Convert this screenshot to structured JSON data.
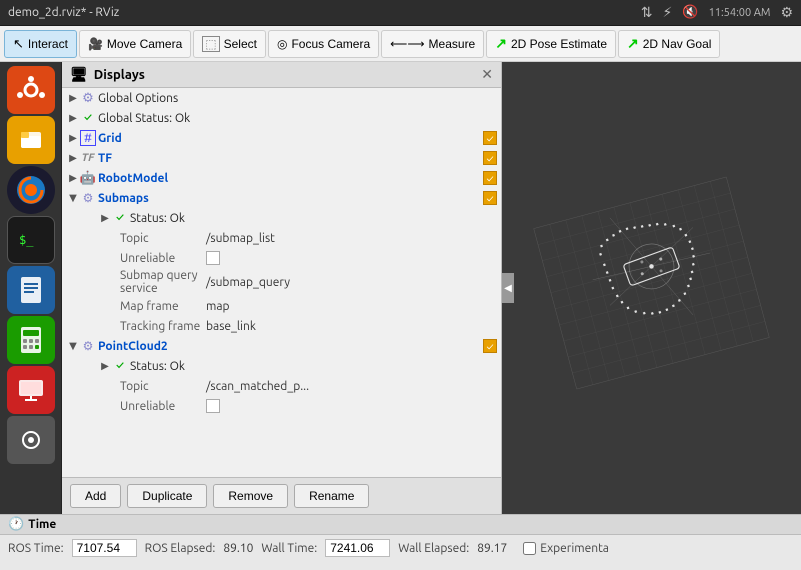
{
  "titlebar": {
    "title": "demo_2d.rviz* - RViz",
    "bluetooth_icon": "bluetooth",
    "sound_icon": "sound",
    "time": "11:54:00 AM",
    "settings_icon": "settings"
  },
  "toolbar": {
    "interact_label": "Interact",
    "move_camera_label": "Move Camera",
    "select_label": "Select",
    "focus_camera_label": "Focus Camera",
    "measure_label": "Measure",
    "pose_estimate_label": "2D Pose Estimate",
    "nav_goal_label": "2D Nav Goal"
  },
  "displays": {
    "title": "Displays",
    "items": [
      {
        "label": "Global Options",
        "indent": 1,
        "type": "options"
      },
      {
        "label": "Global Status: Ok",
        "indent": 1,
        "type": "status",
        "status": "ok"
      },
      {
        "label": "Grid",
        "indent": 1,
        "type": "item",
        "checked": true,
        "color": "blue"
      },
      {
        "label": "TF",
        "indent": 1,
        "type": "item",
        "checked": true,
        "color": "blue"
      },
      {
        "label": "RobotModel",
        "indent": 1,
        "type": "item",
        "checked": true,
        "color": "blue"
      },
      {
        "label": "Submaps",
        "indent": 1,
        "type": "item",
        "checked": true,
        "color": "blue",
        "expanded": true
      },
      {
        "label": "Status: Ok",
        "indent": 2,
        "type": "status"
      },
      {
        "label": "Topic",
        "indent": 2,
        "type": "property",
        "value": "/submap_list"
      },
      {
        "label": "Unreliable",
        "indent": 2,
        "type": "property",
        "value": "",
        "checkbox": true,
        "checked": false
      },
      {
        "label": "Submap query service",
        "indent": 2,
        "type": "property",
        "value": "/submap_query"
      },
      {
        "label": "Map frame",
        "indent": 2,
        "type": "property",
        "value": "map"
      },
      {
        "label": "Tracking frame",
        "indent": 2,
        "type": "property",
        "value": "base_link"
      },
      {
        "label": "PointCloud2",
        "indent": 1,
        "type": "item",
        "checked": true,
        "color": "blue",
        "expanded": true
      },
      {
        "label": "Status: Ok",
        "indent": 2,
        "type": "status"
      },
      {
        "label": "Topic",
        "indent": 2,
        "type": "property",
        "value": "/scan_matched_p..."
      },
      {
        "label": "Unreliable",
        "indent": 2,
        "type": "property",
        "value": "",
        "checkbox": true,
        "checked": false
      }
    ]
  },
  "buttons": {
    "add": "Add",
    "duplicate": "Duplicate",
    "remove": "Remove",
    "rename": "Rename"
  },
  "dock": {
    "icons": [
      "ubuntu",
      "files",
      "firefox",
      "terminal",
      "text",
      "calc",
      "present",
      "app"
    ]
  },
  "statusbar": {
    "time_label": "Time",
    "ros_time_label": "ROS Time:",
    "ros_time_value": "7107.54",
    "ros_elapsed_label": "ROS Elapsed:",
    "ros_elapsed_value": "89.10",
    "wall_time_label": "Wall Time:",
    "wall_time_value": "7241.06",
    "wall_elapsed_label": "Wall Elapsed:",
    "wall_elapsed_value": "89.17",
    "experimental_label": "Experimenta"
  }
}
